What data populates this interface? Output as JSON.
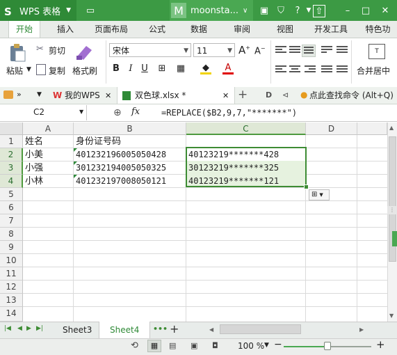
{
  "titlebar": {
    "app_name": "WPS 表格",
    "user_avatar": "M",
    "user_name": "moonsta...",
    "colors": {
      "bar": "#3c9a44",
      "app_btn": "#2f8a37"
    }
  },
  "ribbon_tabs": [
    "开始",
    "插入",
    "页面布局",
    "公式",
    "数据",
    "审阅",
    "视图",
    "开发工具",
    "特色功"
  ],
  "ribbon": {
    "paste": "粘贴",
    "cut": "剪切",
    "copy": "复制",
    "format_painter": "格式刷",
    "font_name": "宋体",
    "font_size": "11",
    "merge": "合并居中"
  },
  "doc_tabs": {
    "my_wps": "我的WPS",
    "file": "双色球.xlsx *",
    "search": "点此查找命令 (Alt+Q)"
  },
  "formula_bar": {
    "name_box": "C2",
    "fx": "fx",
    "formula": "=REPLACE($B2,9,7,\"*******\")"
  },
  "columns": [
    "A",
    "B",
    "C",
    "D"
  ],
  "rows": [
    "1",
    "2",
    "3",
    "4",
    "5",
    "6",
    "7",
    "8",
    "9",
    "10",
    "11",
    "12",
    "13",
    "14"
  ],
  "cells": {
    "A1": "姓名",
    "B1": "身份证号码",
    "A2": "小美",
    "B2": "401232196005050428",
    "C2": "40123219*******428",
    "A3": "小强",
    "B3": "301232194005050325",
    "C3": "30123219*******325",
    "A4": "小林",
    "B4": "401232197008050121",
    "C4": "40123219*******121"
  },
  "sheets": {
    "sheet3": "Sheet3",
    "sheet4": "Sheet4",
    "more": "•••",
    "add": "+"
  },
  "status": {
    "zoom": "100 %",
    "zoom_minus": "−",
    "zoom_plus": "+"
  }
}
